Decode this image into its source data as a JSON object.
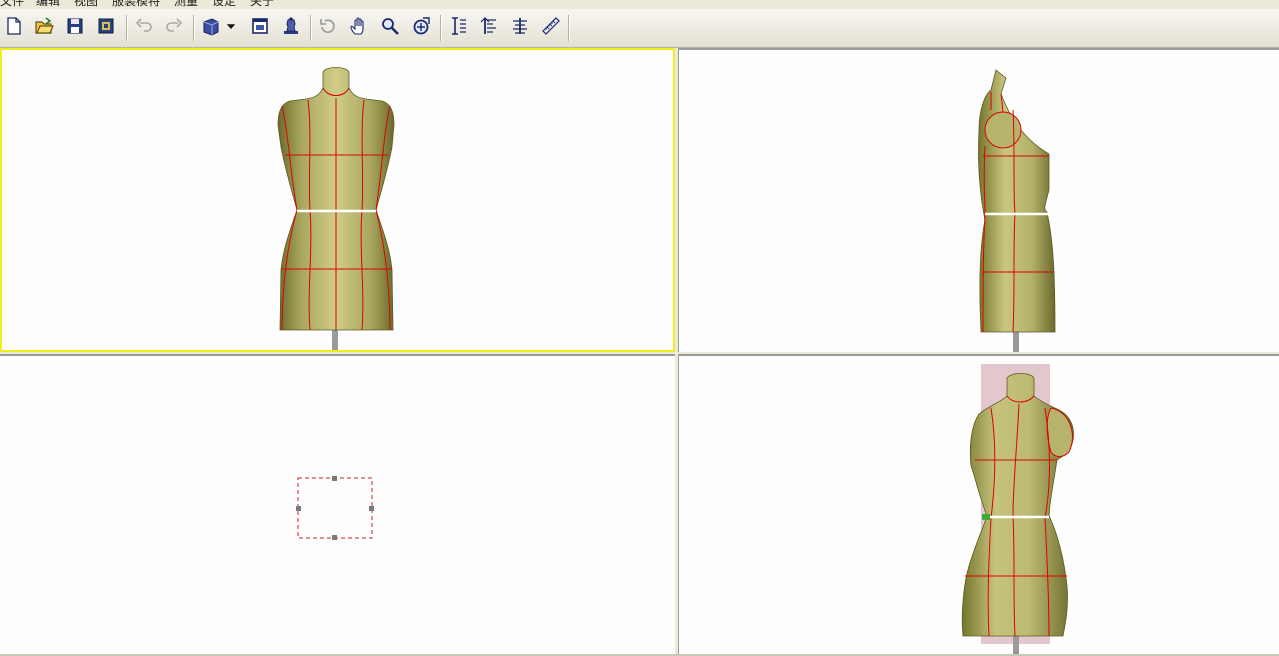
{
  "menu": {
    "items": [
      "文件",
      "编辑",
      "视图",
      "服装模特",
      "测量",
      "设定",
      "关于"
    ]
  },
  "toolbar": {
    "buttons": [
      {
        "name": "new-file-button",
        "icon": "new-document-icon"
      },
      {
        "name": "open-file-button",
        "icon": "open-folder-icon"
      },
      {
        "name": "save-button",
        "icon": "floppy-disk-icon"
      },
      {
        "name": "save-as-button",
        "icon": "save-all-icon"
      },
      {
        "name": "undo-button",
        "icon": "undo-arrow-icon"
      },
      {
        "name": "redo-button",
        "icon": "redo-arrow-icon"
      },
      {
        "name": "view-select-button",
        "icon": "cube-view-icon"
      },
      {
        "name": "view-dropdown-button",
        "icon": "chevron-down-icon"
      },
      {
        "name": "window-layout-button",
        "icon": "window-layout-icon"
      },
      {
        "name": "mannequin-button",
        "icon": "mannequin-icon"
      },
      {
        "name": "rotate-button",
        "icon": "rotate-icon"
      },
      {
        "name": "pan-button",
        "icon": "hand-icon"
      },
      {
        "name": "zoom-button",
        "icon": "magnifier-icon"
      },
      {
        "name": "zoom-fit-button",
        "icon": "zoom-extent-icon"
      },
      {
        "name": "measure-height-button",
        "icon": "measure-vertical-icon"
      },
      {
        "name": "measure-left-button",
        "icon": "measure-left-icon"
      },
      {
        "name": "measure-both-button",
        "icon": "measure-both-icon"
      },
      {
        "name": "ruler-button",
        "icon": "ruler-icon"
      }
    ]
  },
  "colors": {
    "active_viewport_border": "#f2ee1e",
    "mannequin_body": "#c2c078",
    "seam_lines": "#e00000",
    "waist_line": "#ffffff",
    "selection_box": "#d02020",
    "highlight_box": "#d8b4bc",
    "stand_pole": "#9a9a9a"
  },
  "viewports": {
    "active": "front",
    "panes": [
      "front",
      "side",
      "top",
      "perspective"
    ]
  }
}
